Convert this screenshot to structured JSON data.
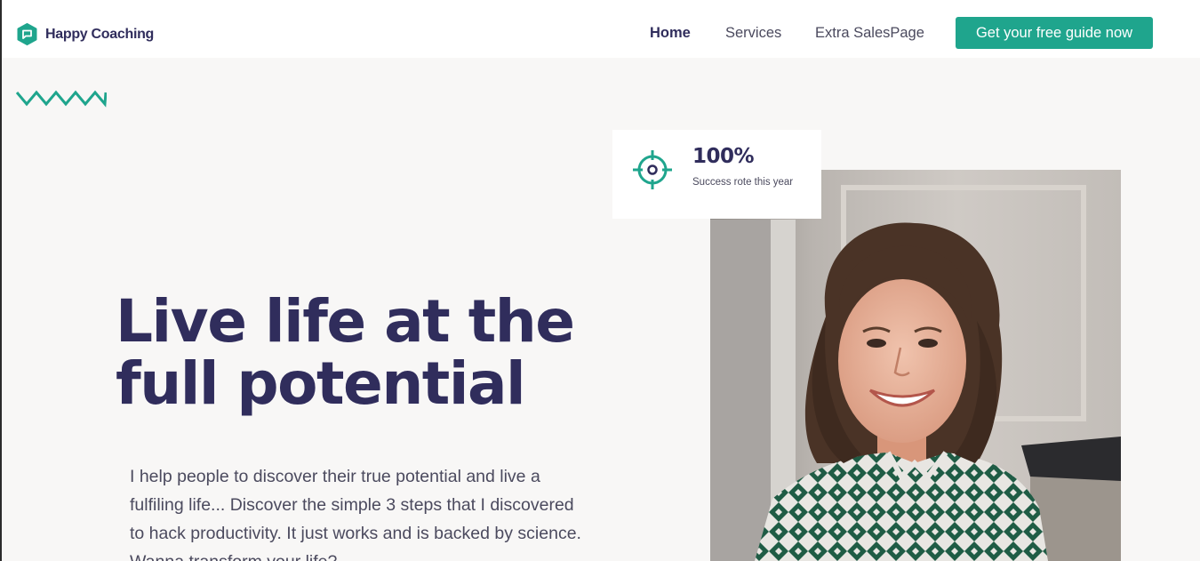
{
  "header": {
    "brand": "Happy Coaching",
    "logo_icon": "chat-bubble-icon",
    "nav": [
      {
        "label": "Home",
        "active": true
      },
      {
        "label": "Services",
        "active": false
      },
      {
        "label": "Extra SalesPage",
        "active": false
      }
    ],
    "cta_label": "Get your free guide now"
  },
  "hero": {
    "headline_line1": "Live life at the",
    "headline_line2": "full potential",
    "lead": "I help people to discover their true potential and live a fulfiling life... Discover the simple 3 steps that I discovered to hack productivity. It just works and is backed by science. Wanna transform your life?"
  },
  "stat": {
    "icon": "target-icon",
    "value": "100%",
    "label": "Success rote this year"
  },
  "colors": {
    "accent": "#1fa58d",
    "heading": "#302d5c",
    "body_text": "#4b4a5e",
    "background": "#f8f7f6"
  }
}
